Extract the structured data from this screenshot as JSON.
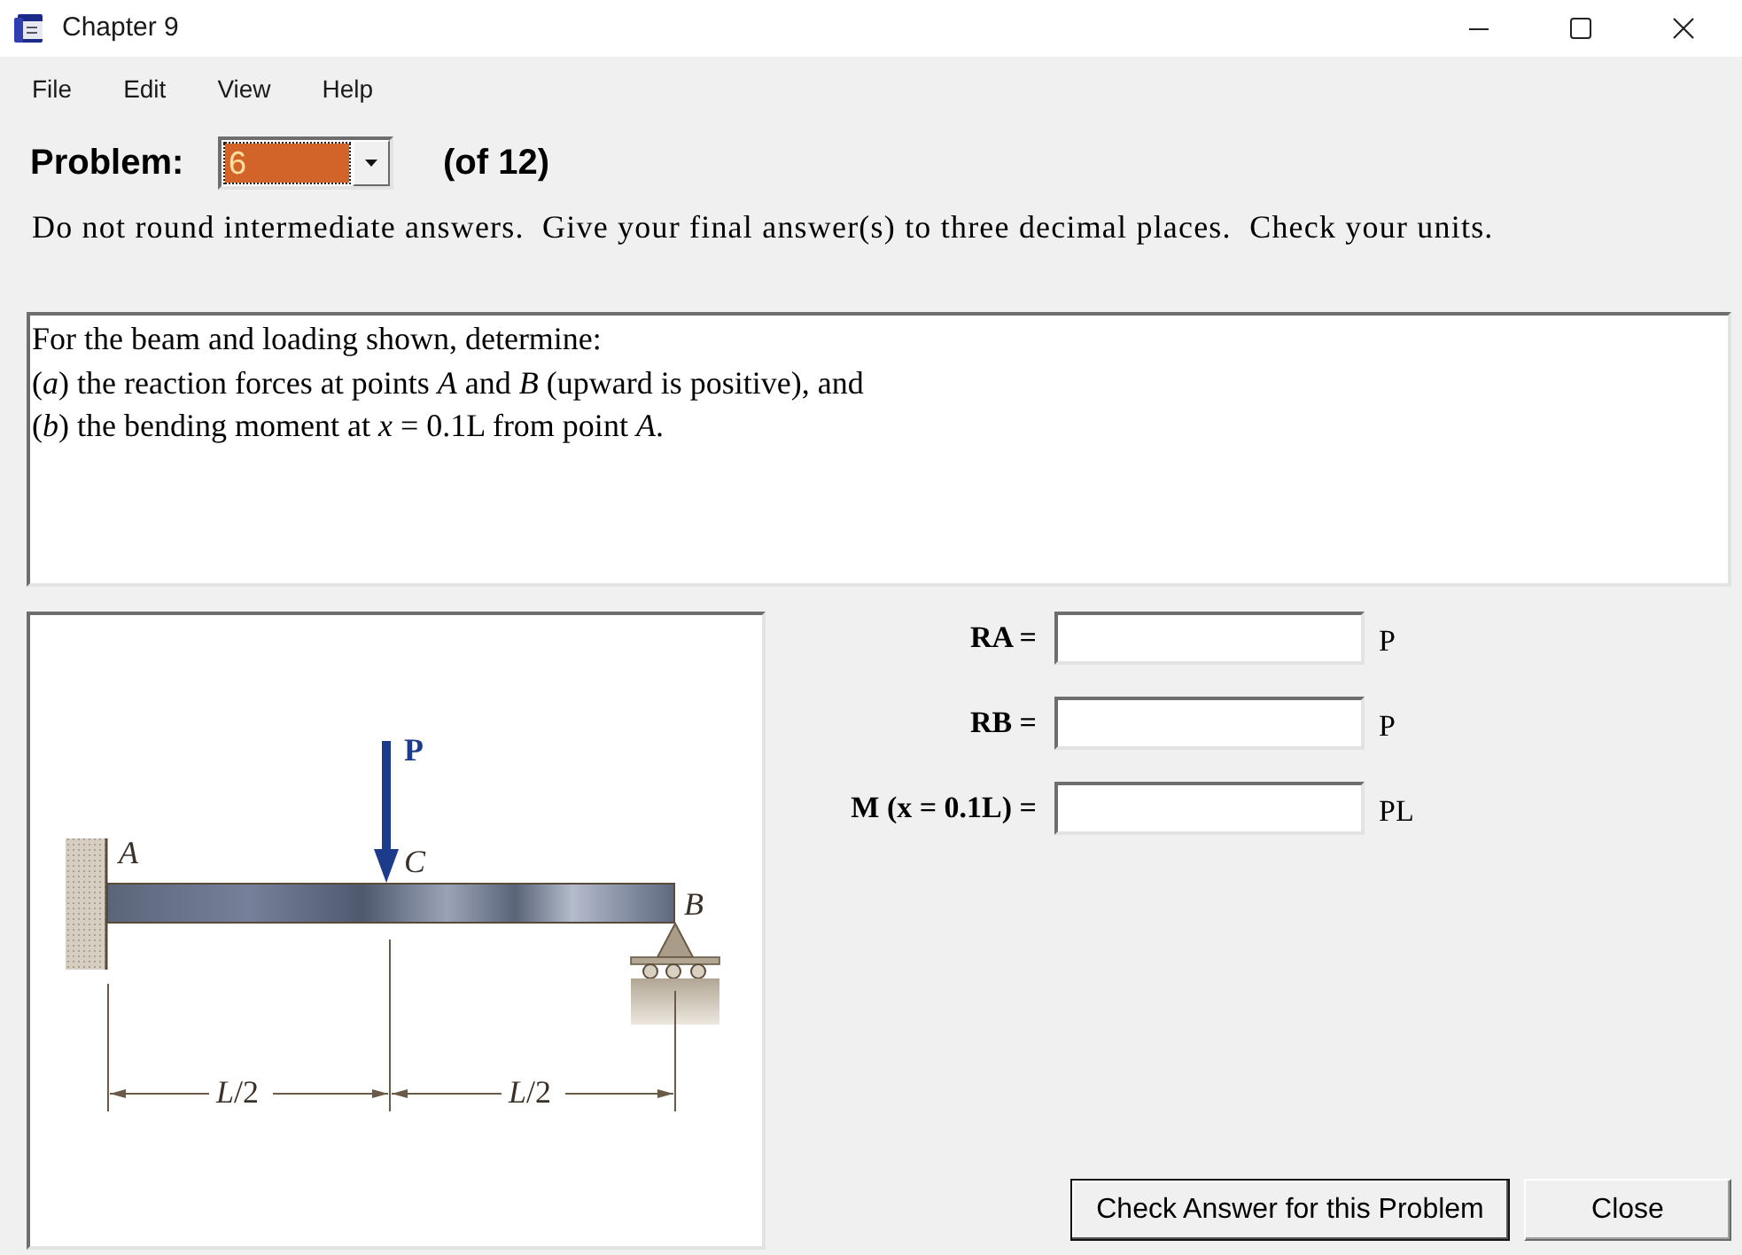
{
  "window": {
    "title": "Chapter 9"
  },
  "menu": [
    "File",
    "Edit",
    "View",
    "Help"
  ],
  "problem_selector": {
    "label": "Problem:",
    "value": "6",
    "focused": true,
    "count": "(of 12)"
  },
  "instructions": "Do not round intermediate answers.  Give your final answer(s) to three decimal places.  Check your units.",
  "problem_text": [
    "For the beam and loading shown, determine:",
    "(*a*) the reaction forces at points *A* and *B* (upward is positive), and",
    "(*b*) the bending moment at *x* = 0.1L from point *A*."
  ],
  "figure": {
    "load_label": "P",
    "point_labels": [
      "A",
      "C",
      "B"
    ],
    "dimension_labels": [
      "*L*/2",
      "*L*/2"
    ]
  },
  "answers": [
    {
      "label": "RA =",
      "unit": "P"
    },
    {
      "label": "RB =",
      "unit": "P"
    },
    {
      "label": "M (x = 0.1L) =",
      "unit": "PL"
    }
  ],
  "buttons": [
    {
      "label": "Check Answer for this Problem",
      "default": true
    },
    {
      "label": "Close",
      "default": false
    }
  ]
}
